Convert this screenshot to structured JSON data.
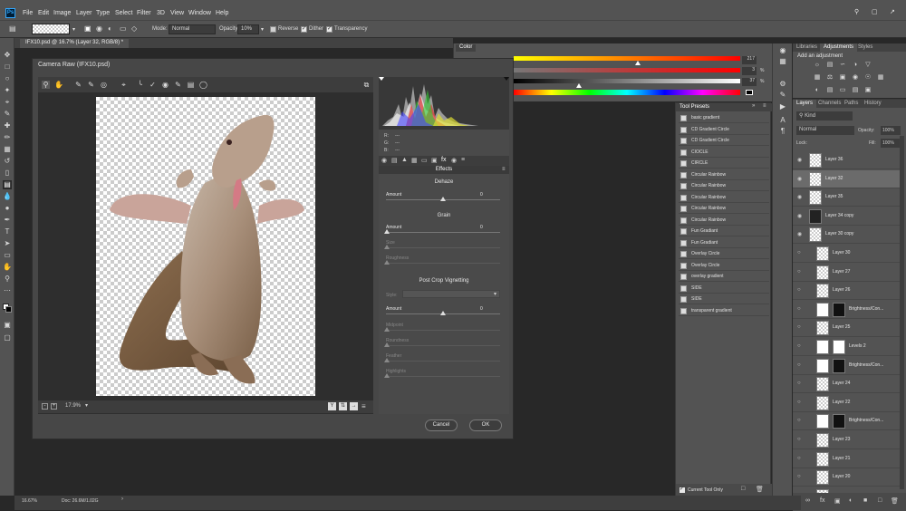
{
  "app": {
    "logo": "Ps",
    "menu": [
      "File",
      "Edit",
      "Image",
      "Layer",
      "Type",
      "Select",
      "Filter",
      "3D",
      "View",
      "Window",
      "Help"
    ]
  },
  "options": {
    "mode_label": "Mode:",
    "mode_value": "Normal",
    "opacity_label": "Opacity:",
    "opacity_value": "10%",
    "reverse": "Reverse",
    "dither": "Dither",
    "transparency": "Transparency"
  },
  "doc_tab": "IFX10.psd @ 16.7% (Layer 32, RGB/8) *",
  "status": {
    "zoom": "16.67%",
    "doc": "Doc: 26.6M/1.02G"
  },
  "color_panel": {
    "title": "Color",
    "values": [
      "217",
      "3",
      "37"
    ],
    "pct": "%"
  },
  "camera_raw": {
    "title": "Camera Raw (IFX10.psd)",
    "zoom": "17.9%",
    "rgb": {
      "r": "R:",
      "g": "G:",
      "b": "B:",
      "r_val": "---",
      "g_val": "---",
      "b_val": "---"
    },
    "effects_title": "Effects",
    "dehaze": {
      "title": "Dehaze",
      "amount_label": "Amount",
      "amount_value": "0"
    },
    "grain": {
      "title": "Grain",
      "amount_label": "Amount",
      "amount_value": "0",
      "size_label": "Size",
      "roughness_label": "Roughness"
    },
    "vignette": {
      "title": "Post Crop Vignetting",
      "style_label": "Style:",
      "amount_label": "Amount",
      "amount_value": "0",
      "midpoint_label": "Midpoint",
      "roundness_label": "Roundness",
      "feather_label": "Feather",
      "highlights_label": "Highlights"
    },
    "cancel": "Cancel",
    "ok": "OK"
  },
  "tool_presets": {
    "title": "Tool Presets",
    "items": [
      "basic gradient",
      "CD Gradient Circle",
      "CD Gradient Circle",
      "CIOCLE",
      "CIRCLE",
      "Circular Rainbow",
      "Circular Rainbow",
      "Circular Rainbow",
      "Circular Rainbow",
      "Circular Rainbow",
      "Fun Gradiant",
      "Fun Gradiant",
      "Overlay Circle",
      "Overlay Circle",
      "overlay gradient",
      "SIDE",
      "SIDE",
      "transparent gradient"
    ],
    "current_only": "Current Tool Only"
  },
  "adjustments": {
    "tabs": [
      "Libraries",
      "Adjustments",
      "Styles"
    ],
    "add_label": "Add an adjustment"
  },
  "layers_panel": {
    "tabs": [
      "Layers",
      "Channels",
      "Paths",
      "History"
    ],
    "kind": "Kind",
    "blend": "Normal",
    "opacity_label": "Opacity:",
    "opacity": "100%",
    "lock_label": "Lock:",
    "fill_label": "Fill:",
    "fill": "100%",
    "layers": [
      "Layer 36",
      "Layer 32",
      "Layer 35",
      "Layer 34 copy",
      "Layer 30 copy",
      "Layer 30",
      "Layer 27",
      "Layer 26",
      "Brightness/Con...",
      "Layer 25",
      "Levels 2",
      "Brightness/Con...",
      "Layer 24",
      "Layer 22",
      "Brightness/Con...",
      "Layer 23",
      "Layer 21",
      "Layer 20",
      "Layer 19"
    ]
  }
}
